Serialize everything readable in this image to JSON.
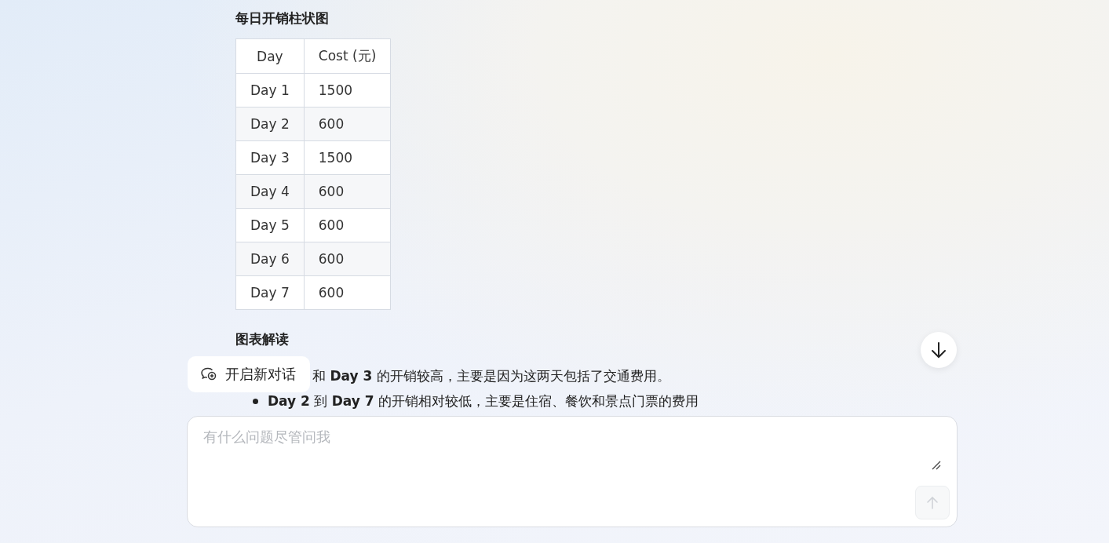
{
  "section_title": "每日开销柱状图",
  "table": {
    "columns": [
      "Day",
      "Cost (元)"
    ],
    "rows": [
      [
        "Day 1",
        "1500"
      ],
      [
        "Day 2",
        "600"
      ],
      [
        "Day 3",
        "1500"
      ],
      [
        "Day 4",
        "600"
      ],
      [
        "Day 5",
        "600"
      ],
      [
        "Day 6",
        "600"
      ],
      [
        "Day 7",
        "600"
      ]
    ]
  },
  "analysis_title": "图表解读",
  "bullets": [
    {
      "text": "和 **Day 3** 的开销较高，主要是因为这两天包括了交通费用。",
      "partly_hidden": true
    },
    {
      "text": "**Day 2** 到 **Day 7** 的开销相对较低，主要是住宿、餐饮和景点门票的费用",
      "partly_hidden": false
    }
  ],
  "new_chat_button": "开启新对话",
  "composer": {
    "placeholder": "有什么问题尽管问我",
    "send_disabled": true
  }
}
